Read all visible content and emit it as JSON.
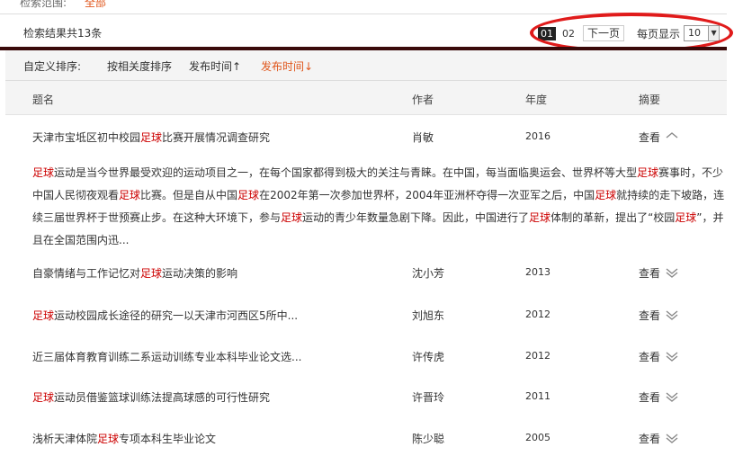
{
  "scope": {
    "label": "检索范围:",
    "value": "全部"
  },
  "results": {
    "count_text": "检索结果共13条"
  },
  "pager": {
    "pages": [
      "01",
      "02"
    ],
    "current": "01",
    "next_label": "下一页",
    "per_page_label": "每页显示",
    "per_page_value": "10"
  },
  "sort": {
    "label": "自定义排序:",
    "options": [
      "按相关度排序",
      "发布时间↑",
      "发布时间↓"
    ],
    "active": "发布时间↓"
  },
  "table": {
    "headers": {
      "title": "题名",
      "author": "作者",
      "year": "年度",
      "abstract": "摘要"
    },
    "view_label": "查看",
    "rows": [
      {
        "title": "天津市宝坻区初中校园足球比赛开展情况调查研究",
        "author": "肖敏",
        "year": "2016",
        "expanded": true
      },
      {
        "title": "自豪情绪与工作记忆对足球运动决策的影响",
        "author": "沈小芳",
        "year": "2013",
        "expanded": false
      },
      {
        "title": "足球运动校园成长途径的研究一以天津市河西区5所中...",
        "author": "刘旭东",
        "year": "2012",
        "expanded": false
      },
      {
        "title": "近三届体育教育训练二系运动训练专业本科毕业论文选...",
        "author": "许传虎",
        "year": "2012",
        "expanded": false
      },
      {
        "title": "足球运动员借鉴篮球训练法提高球感的可行性研究",
        "author": "许晋玲",
        "year": "2011",
        "expanded": false
      },
      {
        "title": "浅析天津体院足球专项本科生毕业论文",
        "author": "陈少聪",
        "year": "2005",
        "expanded": false
      }
    ],
    "abstract_text": "足球运动是当今世界最受欢迎的运动项目之一，在每个国家都得到极大的关注与青睐。在中国，每当面临奥运会、世界杯等大型足球赛事时，不少中国人民彻夜观看足球比赛。但是自从中国足球在2002年第一次参加世界杯，2004年亚洲杯夺得一次亚军之后，中国足球就持续的走下坡路，连续三届世界杯于世预赛止步。在这种大环境下，参与足球运动的青少年数量急剧下降。因此，中国进行了足球体制的革新，提出了“校园足球”，并且在全国范围内迅..."
  },
  "keyword": "足球",
  "colors": {
    "keyword": "#cc0000",
    "accent": "#e0571d",
    "divider": "#3a0a0a",
    "ring": "#e01b1b"
  }
}
